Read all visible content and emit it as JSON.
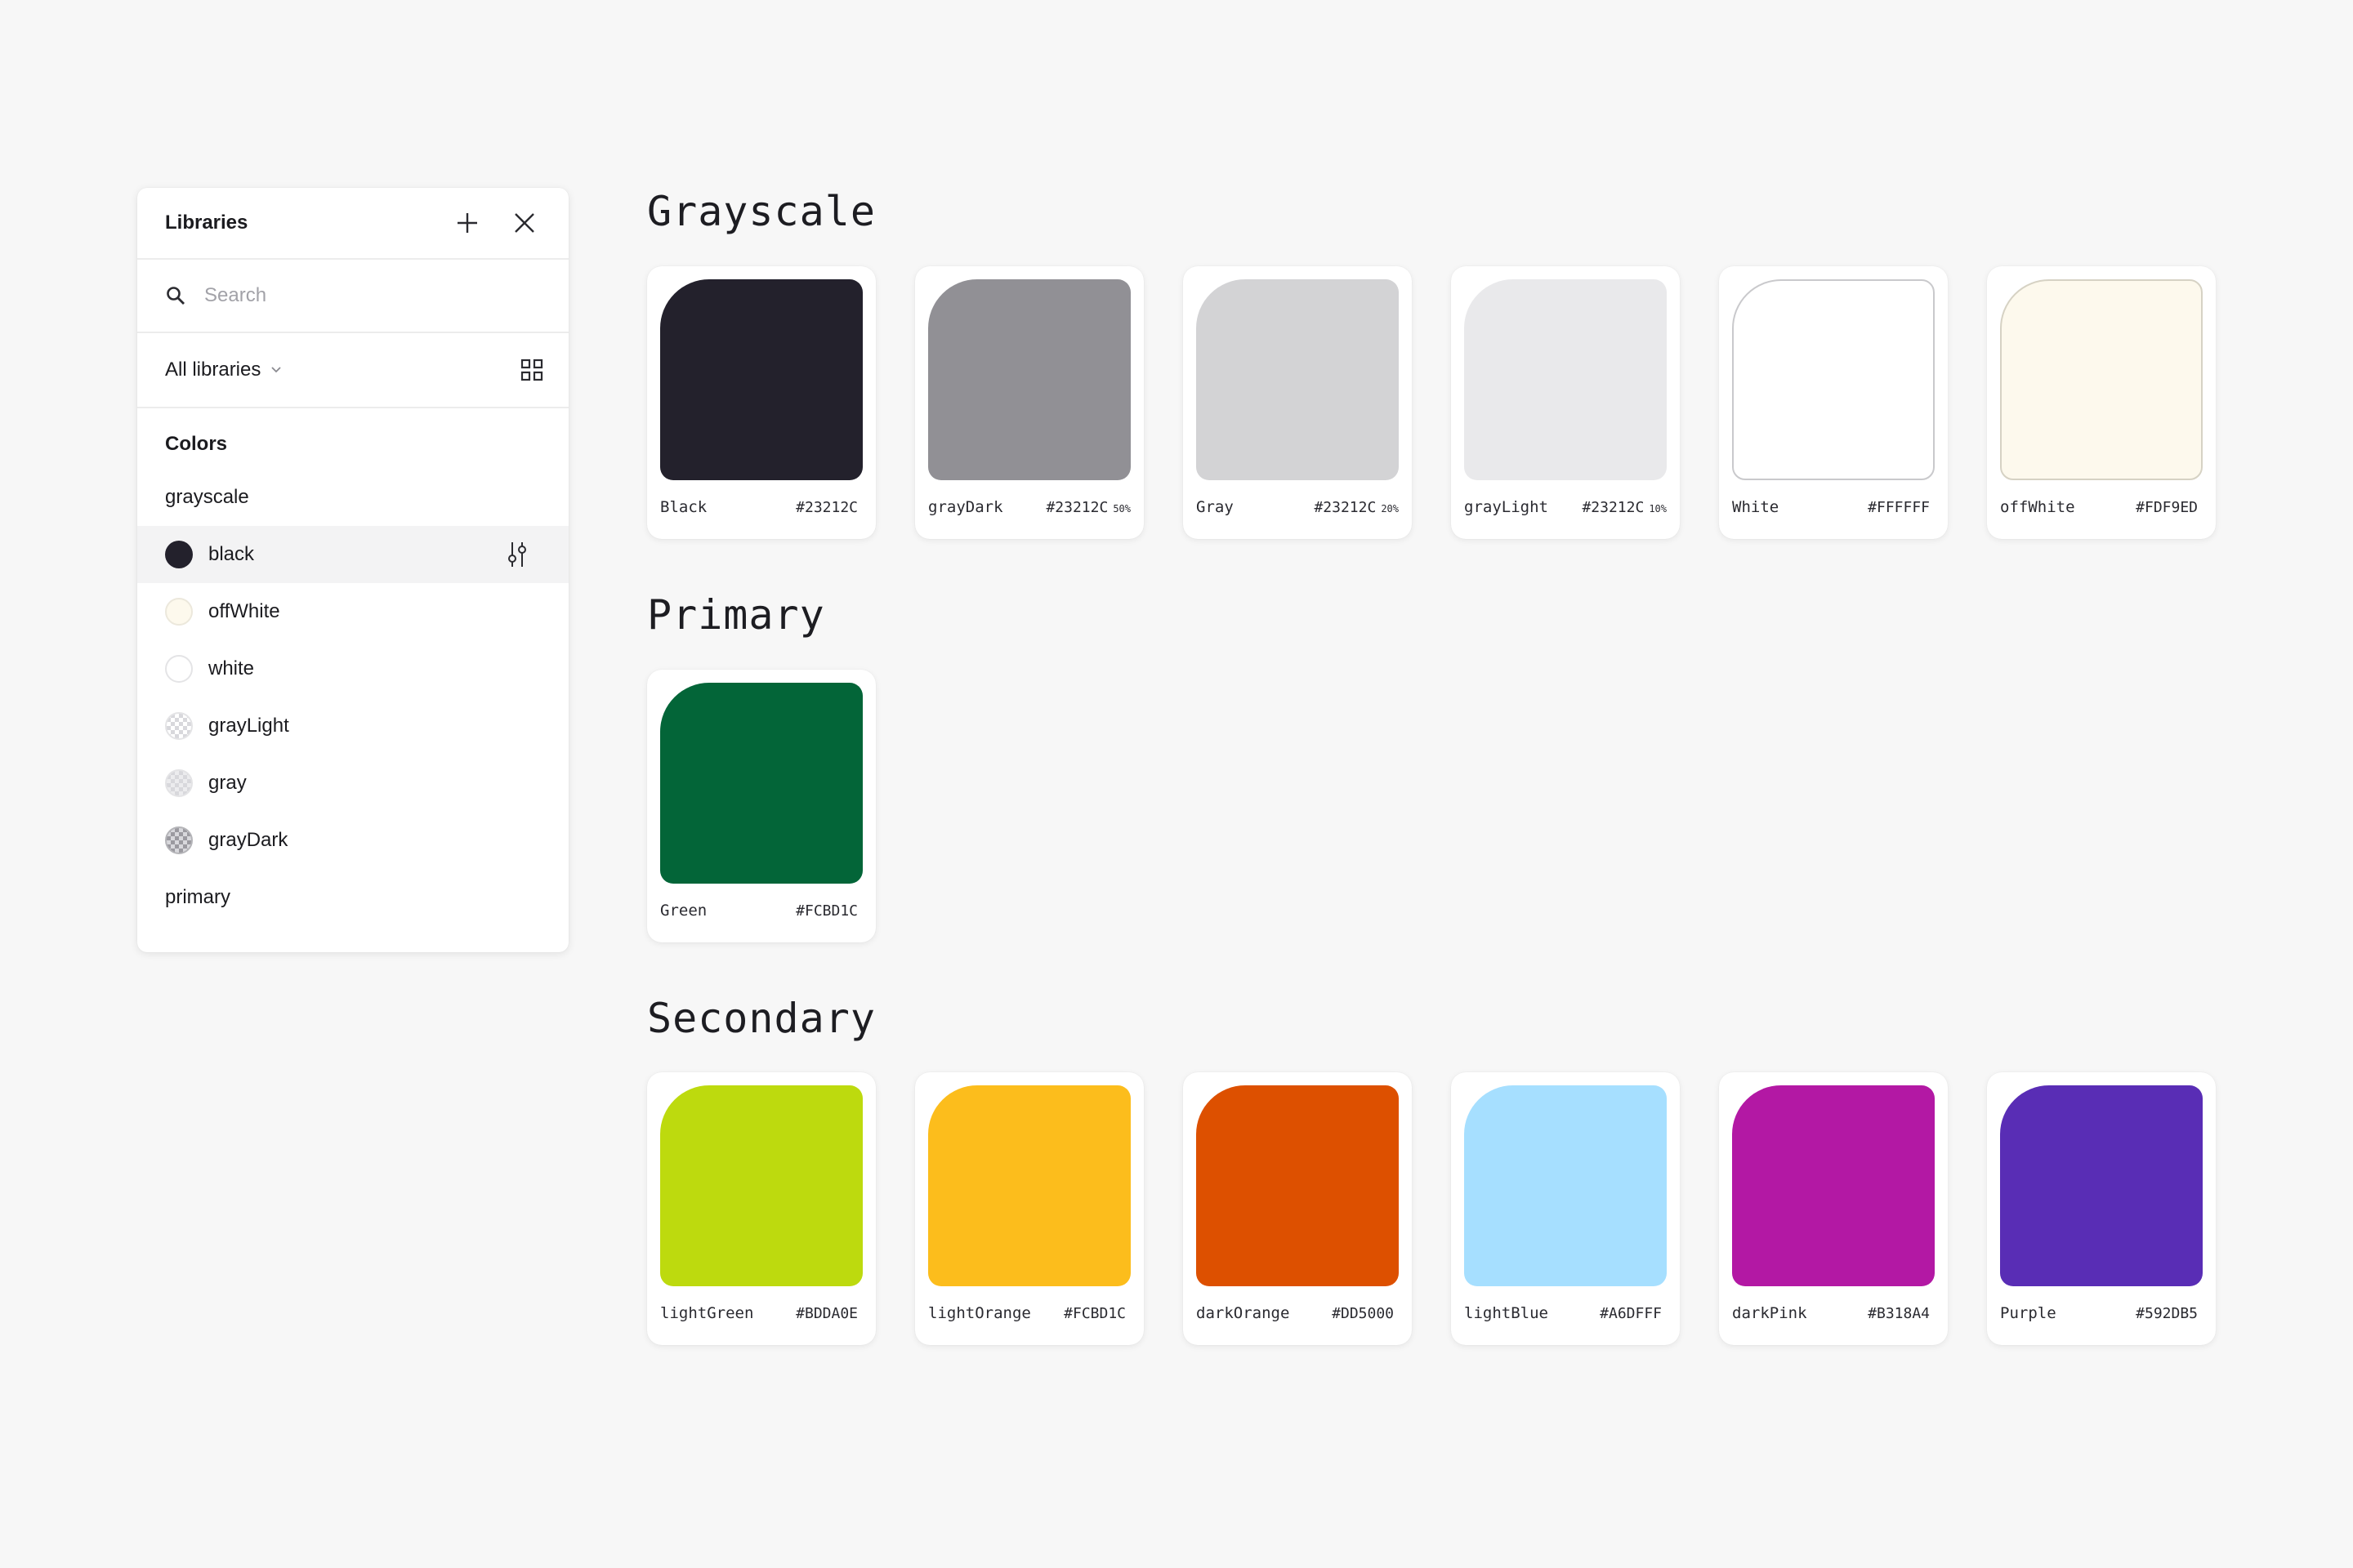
{
  "panel": {
    "title": "Libraries",
    "search_placeholder": "Search",
    "filter_label": "All libraries",
    "colors_heading": "Colors",
    "group_grayscale": "grayscale",
    "group_primary": "primary",
    "items": [
      {
        "label": "black",
        "color": "#23212C"
      },
      {
        "label": "offWhite",
        "color": "#FDF9ED"
      },
      {
        "label": "white",
        "color": "#FFFFFF"
      },
      {
        "label": "grayLight",
        "color": "#23212C"
      },
      {
        "label": "gray",
        "color": "#23212C"
      },
      {
        "label": "grayDark",
        "color": "#23212C"
      }
    ]
  },
  "sections": {
    "grayscale": {
      "title": "Grayscale",
      "cards": [
        {
          "name": "Black",
          "hex": "#23212C",
          "opacity": "",
          "color": "#23212C"
        },
        {
          "name": "grayDark",
          "hex": "#23212C",
          "opacity": "50%",
          "color": "#919095"
        },
        {
          "name": "Gray",
          "hex": "#23212C",
          "opacity": "20%",
          "color": "#d3d3d5"
        },
        {
          "name": "grayLight",
          "hex": "#23212C",
          "opacity": "10%",
          "color": "#e9e9eb"
        },
        {
          "name": "White",
          "hex": "#FFFFFF",
          "opacity": "",
          "color": "#FFFFFF"
        },
        {
          "name": "offWhite",
          "hex": "#FDF9ED",
          "opacity": "",
          "color": "#FDF9ED"
        }
      ]
    },
    "primary": {
      "title": "Primary",
      "cards": [
        {
          "name": "Green",
          "hex": "#FCBD1C",
          "opacity": "",
          "color": "#036538"
        }
      ]
    },
    "secondary": {
      "title": "Secondary",
      "cards": [
        {
          "name": "lightGreen",
          "hex": "#BDDA0E",
          "opacity": "",
          "color": "#BDDA0E"
        },
        {
          "name": "lightOrange",
          "hex": "#FCBD1C",
          "opacity": "",
          "color": "#FCBD1C"
        },
        {
          "name": "darkOrange",
          "hex": "#DD5000",
          "opacity": "",
          "color": "#DD5000"
        },
        {
          "name": "lightBlue",
          "hex": "#A6DFFF",
          "opacity": "",
          "color": "#A6DFFF"
        },
        {
          "name": "darkPink",
          "hex": "#B318A4",
          "opacity": "",
          "color": "#B318A4"
        },
        {
          "name": "Purple",
          "hex": "#592DB5",
          "opacity": "",
          "color": "#592DB5"
        }
      ]
    }
  }
}
